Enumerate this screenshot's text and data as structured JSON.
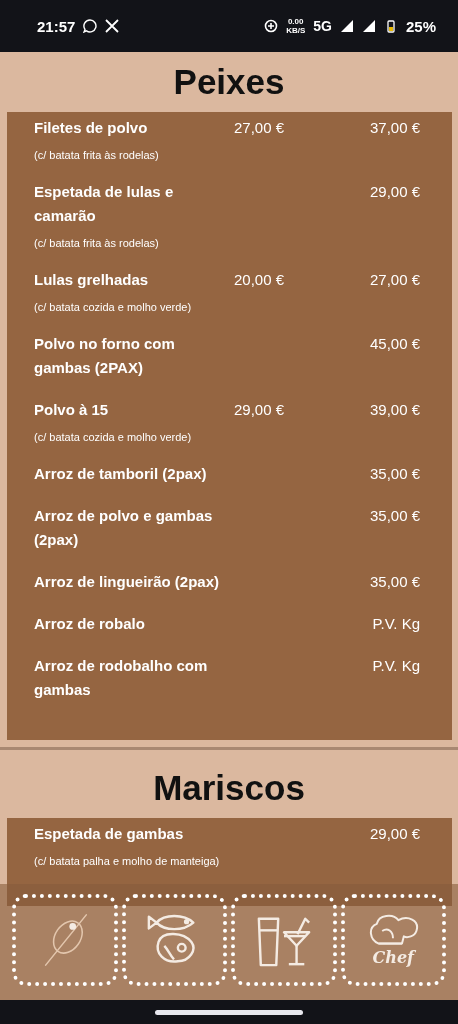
{
  "status_bar": {
    "time": "21:57",
    "speed_value": "0.00",
    "speed_unit": "KB/S",
    "network": "5G",
    "battery": "25%"
  },
  "sections": [
    {
      "title": "Peixes",
      "items": [
        {
          "name": "Filetes de polvo",
          "note": "(c/ batata frita às rodelas)",
          "price_1": "27,00 €",
          "price_2": "37,00 €"
        },
        {
          "name": "Espetada de lulas e camarão",
          "note": "(c/ batata frita às rodelas)",
          "price_2": "29,00 €"
        },
        {
          "name": "Lulas grelhadas",
          "note": "(c/ batata cozida e molho verde)",
          "price_1": "20,00 €",
          "price_2": "27,00 €"
        },
        {
          "name": "Polvo no forno com gambas (2PAX)",
          "price_2": "45,00 €"
        },
        {
          "name": "Polvo à 15",
          "note": "(c/ batata cozida e molho verde)",
          "price_1": "29,00 €",
          "price_2": "39,00 €"
        },
        {
          "name": "Arroz de tamboril (2pax)",
          "price_2": "35,00 €"
        },
        {
          "name": "Arroz de polvo e gambas (2pax)",
          "price_2": "35,00 €"
        },
        {
          "name": "Arroz de lingueirão (2pax)",
          "price_2": "35,00 €"
        },
        {
          "name": "Arroz de robalo",
          "price_2": "P.V. Kg"
        },
        {
          "name": "Arroz de rodobalho com gambas",
          "price_2": "P.V. Kg"
        }
      ]
    },
    {
      "title": "Mariscos",
      "items": [
        {
          "name": "Espetada de gambas",
          "note": "(c/ batata palha e molho de manteiga)",
          "price_2": "29,00 €"
        }
      ]
    }
  ],
  "bottom_nav": [
    {
      "kind": "snacks"
    },
    {
      "kind": "food"
    },
    {
      "kind": "drinks"
    },
    {
      "kind": "chef",
      "label": "Chef"
    }
  ]
}
